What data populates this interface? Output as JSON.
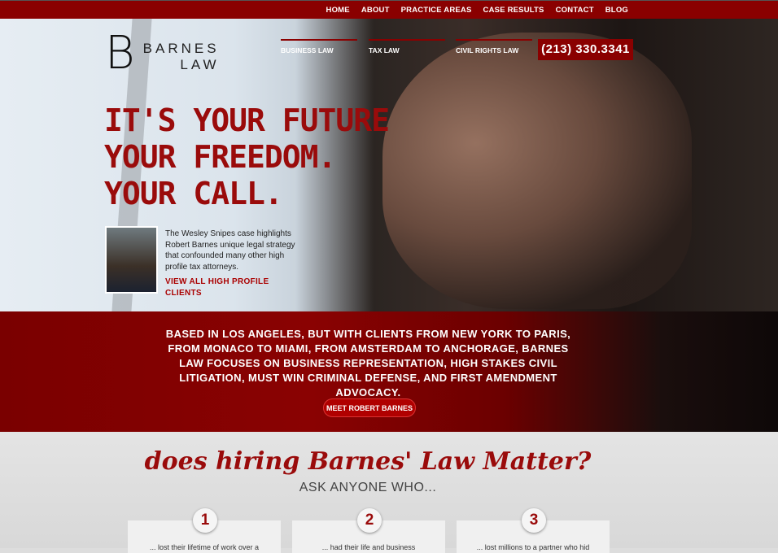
{
  "topnav": [
    "HOME",
    "ABOUT",
    "PRACTICE AREAS",
    "CASE RESULTS",
    "CONTACT",
    "BLOG"
  ],
  "logo": {
    "letter": "B",
    "name": "BARNES",
    "sub": "LAW"
  },
  "practice_nav": [
    "BUSINESS LAW",
    "TAX LAW",
    "CIVIL RIGHTS LAW"
  ],
  "phone": "(213) 330.3341",
  "headline": [
    "IT'S YOUR FUTURE",
    "YOUR FREEDOM.",
    "YOUR CALL."
  ],
  "feature": {
    "text": "The Wesley Snipes case highlights Robert Barnes unique legal strategy that confounded many other high profile tax attorneys.",
    "link": "VIEW ALL HIGH PROFILE CLIENTS"
  },
  "band": {
    "text": "BASED IN LOS ANGELES, BUT WITH CLIENTS FROM NEW YORK TO PARIS, FROM MONACO TO MIAMI, FROM AMSTERDAM TO ANCHORAGE, BARNES LAW FOCUSES ON BUSINESS REPRESENTATION, HIGH STAKES CIVIL LITIGATION, MUST WIN CRIMINAL DEFENSE, AND FIRST AMENDMENT ADVOCACY.",
    "button": "MEET ROBERT BARNES"
  },
  "section": {
    "title": "does hiring Barnes' Law Matter?",
    "subtitle": "ASK ANYONE WHO...",
    "cards": [
      {
        "num": "1",
        "text": "... lost their lifetime of work over a"
      },
      {
        "num": "2",
        "text": "... had their life and business"
      },
      {
        "num": "3",
        "text": "... lost millions to a partner who hid"
      }
    ]
  }
}
